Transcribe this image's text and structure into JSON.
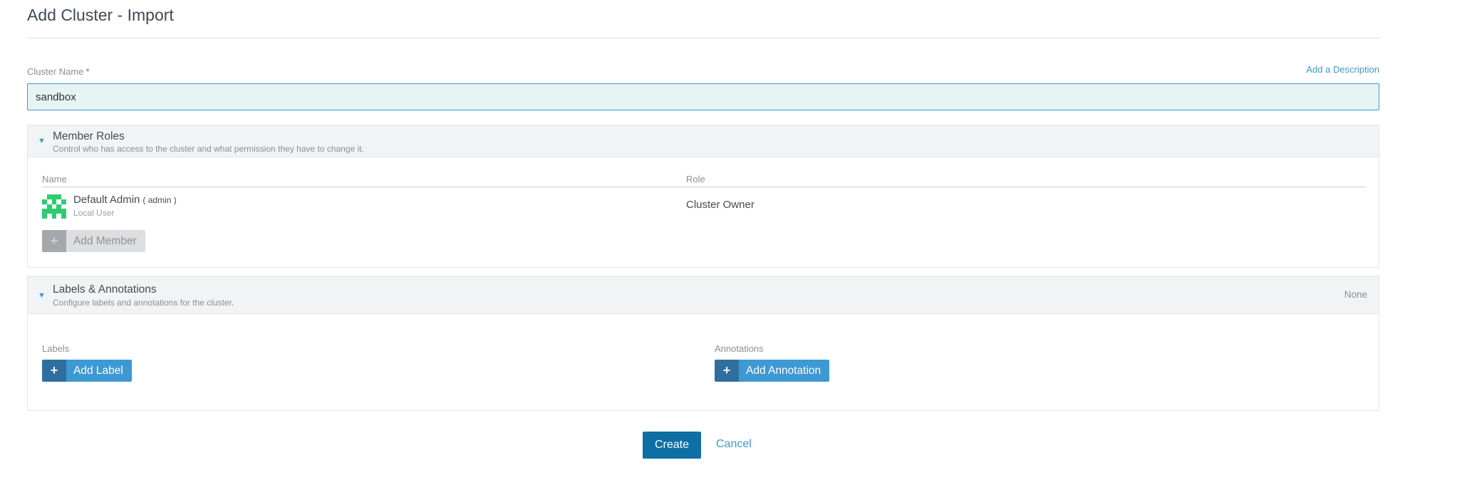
{
  "page": {
    "title": "Add Cluster - Import"
  },
  "cluster_name": {
    "label": "Cluster Name",
    "required_marker": "*",
    "value": "sandbox",
    "add_description_link": "Add a Description"
  },
  "member_roles": {
    "toggle_icon": "triangle-down-icon",
    "title": "Member Roles",
    "subtitle": "Control who has access to the cluster and what permission they have to change it.",
    "columns": {
      "name": "Name",
      "role": "Role"
    },
    "members": [
      {
        "name": "Default Admin",
        "login": "( admin )",
        "type": "Local User",
        "role": "Cluster Owner",
        "avatar_icon": "identicon-avatar",
        "avatar_color": "#2ecc71"
      }
    ],
    "add_member": {
      "icon": "plus-icon",
      "label": "Add Member"
    }
  },
  "labels_annotations": {
    "toggle_icon": "triangle-down-icon",
    "title": "Labels & Annotations",
    "subtitle": "Configure labels and annotations for the cluster.",
    "status": "None",
    "labels": {
      "heading": "Labels",
      "button_icon": "plus-icon",
      "button_label": "Add Label"
    },
    "annotations": {
      "heading": "Annotations",
      "button_icon": "plus-icon",
      "button_label": "Add Annotation"
    }
  },
  "footer": {
    "create_label": "Create",
    "cancel_label": "Cancel"
  },
  "colors": {
    "accent": "#3d98d3",
    "primary_button": "#0f6fa5",
    "input_background": "#e6f4f3",
    "required": "#d9534f"
  }
}
